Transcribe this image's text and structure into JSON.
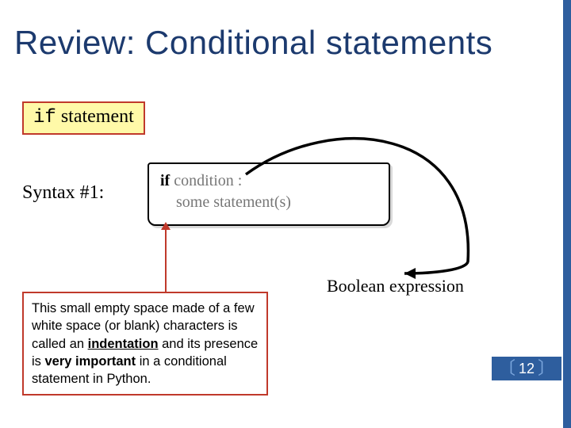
{
  "title": "Review: Conditional statements",
  "if_box": {
    "keyword": "if",
    "rest": " statement"
  },
  "syntax_label": "Syntax #1:",
  "code": {
    "line1_kw": "if",
    "line1_rest": " condition :",
    "line2_indent": "    ",
    "line2_rest": "some statement(s)"
  },
  "callout": {
    "t1": "This small empty space made of a few white space (or blank) characters is called an ",
    "indentation": "indentation",
    "t2": " and its presence is ",
    "very_important": "very important",
    "t3": " in a conditional statement in Python."
  },
  "bool_label": "Boolean expression",
  "page_number": "12"
}
